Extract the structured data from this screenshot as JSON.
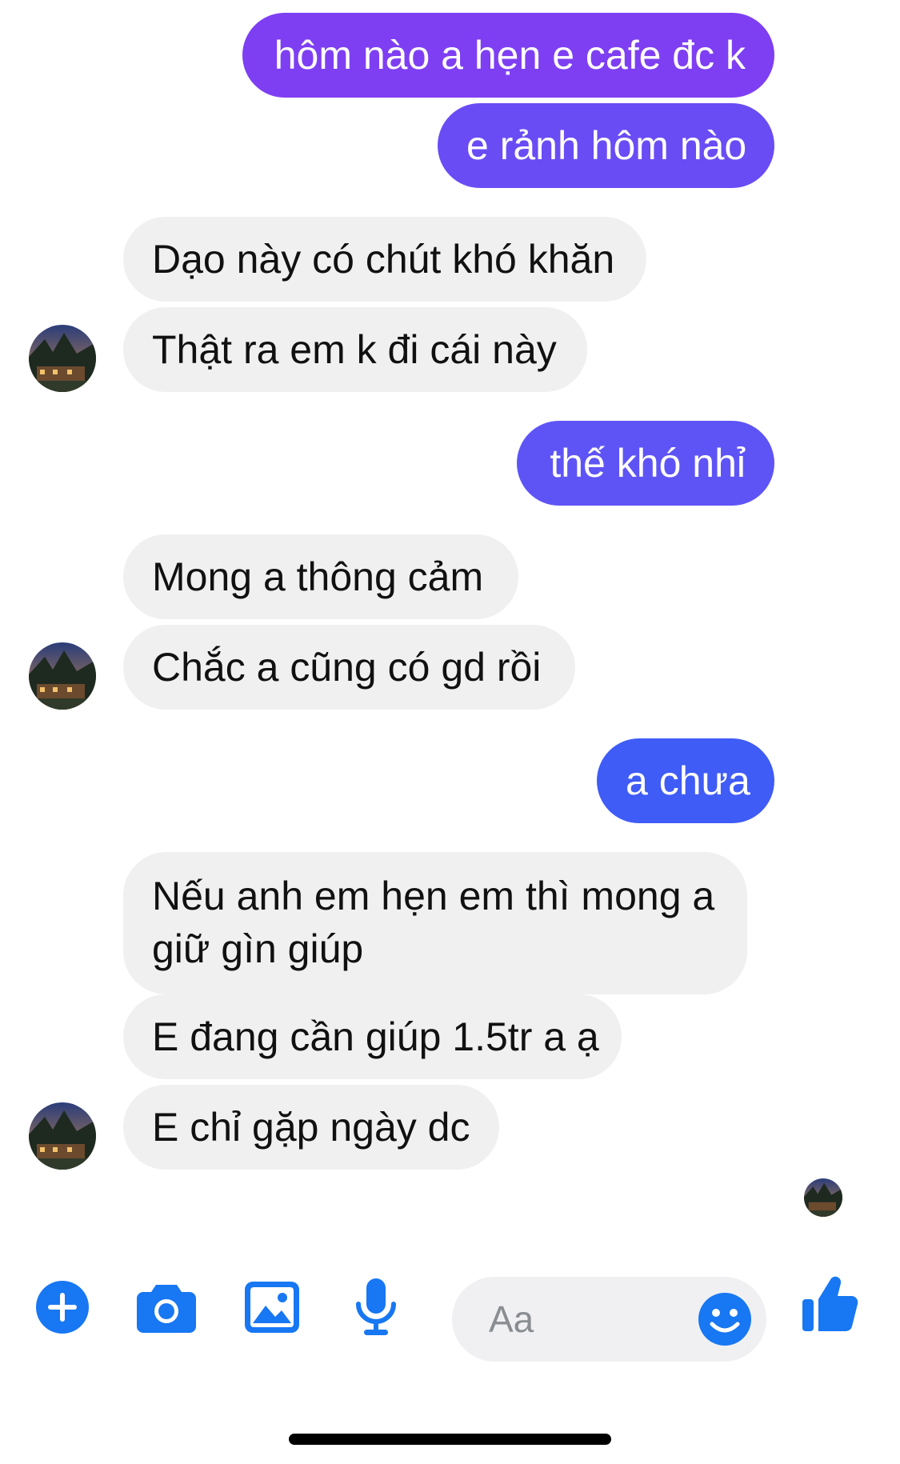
{
  "colors": {
    "sent_gradient_top": "#7c3aed",
    "sent_gradient_bottom": "#3b5bf6",
    "received_bg": "#f0f0f0",
    "accent": "#1877f2"
  },
  "messages": [
    {
      "direction": "sent",
      "text": "hôm nào a hẹn e cafe đc k"
    },
    {
      "direction": "sent",
      "text": "e rảnh hôm nào"
    },
    {
      "direction": "received",
      "text": "Dạo này có chút khó khăn"
    },
    {
      "direction": "received",
      "text": "Thật ra em k đi cái này"
    },
    {
      "direction": "sent",
      "text": "thế khó nhỉ"
    },
    {
      "direction": "received",
      "text": "Mong a thông cảm"
    },
    {
      "direction": "received",
      "text": "Chắc a cũng có gd rồi"
    },
    {
      "direction": "sent",
      "text": "a chưa"
    },
    {
      "direction": "received",
      "text": "Nếu anh em hẹn em thì mong a giữ gìn giúp"
    },
    {
      "direction": "received",
      "text": "E đang cần giúp 1.5tr a ạ"
    },
    {
      "direction": "received",
      "text": "E chỉ gặp ngày dc"
    }
  ],
  "composer": {
    "placeholder": "Aa",
    "icons": [
      "plus-icon",
      "camera-icon",
      "image-icon",
      "microphone-icon",
      "smiley-icon",
      "thumbs-up-icon"
    ]
  }
}
